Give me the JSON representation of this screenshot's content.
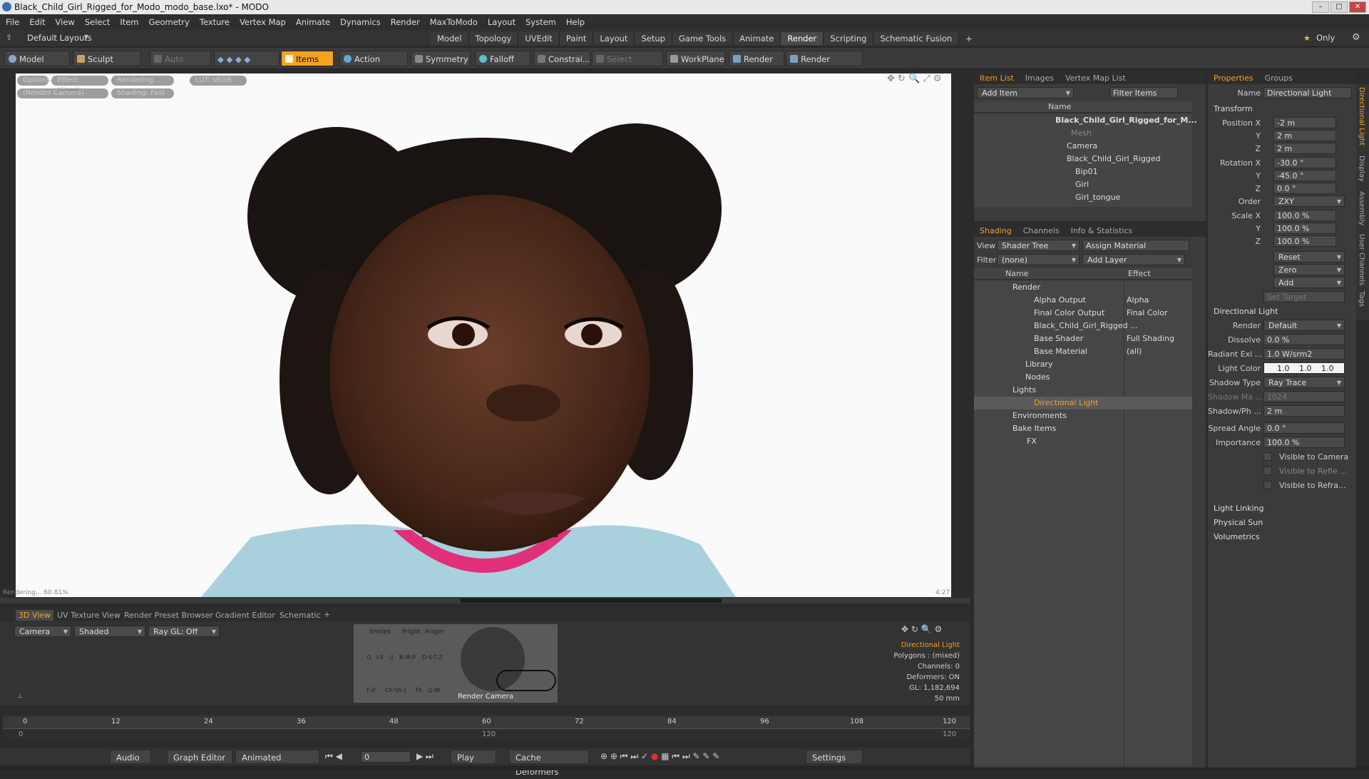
{
  "window": {
    "title": "Black_Child_Girl_Rigged_for_Modo_modo_base.lxo* - MODO"
  },
  "menu": [
    "File",
    "Edit",
    "View",
    "Select",
    "Item",
    "Geometry",
    "Texture",
    "Vertex Map",
    "Animate",
    "Dynamics",
    "Render",
    "MaxToModo",
    "Layout",
    "System",
    "Help"
  ],
  "layout": {
    "current": "Default Layouts",
    "tabs": [
      "Model",
      "Topology",
      "UVEdit",
      "Paint",
      "Layout",
      "Setup",
      "Game Tools",
      "Animate",
      "Render",
      "Scripting",
      "Schematic Fusion"
    ],
    "active_tab": "Render",
    "plus": "+",
    "only": "Only"
  },
  "toolbar": {
    "model": "Model",
    "sculpt": "Sculpt",
    "auto_select": "Auto Select",
    "items": "Items",
    "action_center": "Action Center",
    "symmetry": "Symmetry",
    "falloff": "Falloff",
    "constraints": "Constrai...",
    "select_through": "Select Through",
    "workplane": "WorkPlane",
    "render": "Render",
    "render_window": "Render Window"
  },
  "viewport": {
    "options": "Options",
    "effect": "Effect: (Shadi...",
    "rendering": "Rendering...",
    "lut": "LUT: sRGB",
    "camera": "(Render Camera)",
    "shading": "Shading: Fast",
    "corner_left": "Rendering... 60.81%",
    "corner_right": "4:27"
  },
  "item_list": {
    "tabs": [
      "Item List",
      "Images",
      "Vertex Map List"
    ],
    "add_item": "Add Item",
    "filter_items": "Filter Items",
    "col_name": "Name",
    "items": [
      "Black_Child_Girl_Rigged_for_M...",
      "Mesh",
      "Camera",
      "Black_Child_Girl_Rigged",
      "Bip01",
      "Girl",
      "Girl_tongue"
    ]
  },
  "shading": {
    "tabs": [
      "Shading",
      "Channels",
      "Info & Statistics"
    ],
    "view_label": "View",
    "view_value": "Shader Tree",
    "assign_material": "Assign Material",
    "filter_label": "Filter",
    "filter_value": "(none)",
    "add_layer": "Add Layer",
    "col_name": "Name",
    "col_effect": "Effect",
    "rows": [
      {
        "name": "Render",
        "effect": ""
      },
      {
        "name": "Alpha Output",
        "effect": "Alpha"
      },
      {
        "name": "Final Color Output",
        "effect": "Final Color"
      },
      {
        "name": "Black_Child_Girl_Rigged ...",
        "effect": ""
      },
      {
        "name": "Base Shader",
        "effect": "Full Shading"
      },
      {
        "name": "Base Material",
        "effect": "(all)"
      },
      {
        "name": "Library",
        "effect": ""
      },
      {
        "name": "Nodes",
        "effect": ""
      },
      {
        "name": "Lights",
        "effect": ""
      },
      {
        "name": "Directional Light",
        "effect": ""
      },
      {
        "name": "Environments",
        "effect": ""
      },
      {
        "name": "Bake Items",
        "effect": ""
      },
      {
        "name": "FX",
        "effect": ""
      }
    ]
  },
  "properties": {
    "tabs": [
      "Properties",
      "Groups"
    ],
    "name_label": "Name",
    "name_value": "Directional Light",
    "transform": "Transform",
    "pos_label": "Position X",
    "pos": [
      "-2 m",
      "2 m",
      "2 m"
    ],
    "rot_label": "Rotation X",
    "rot": [
      "-30.0 °",
      "-45.0 °",
      "0.0 °"
    ],
    "y": "Y",
    "z": "Z",
    "order_label": "Order",
    "order": "ZXY",
    "scale_label": "Scale X",
    "scale": [
      "100.0 %",
      "100.0 %",
      "100.0 %"
    ],
    "reset": "Reset",
    "zero": "Zero",
    "add": "Add",
    "set_target": "Set Target",
    "dl_section": "Directional Light",
    "render_label": "Render",
    "render_value": "Default",
    "dissolve_label": "Dissolve",
    "dissolve": "0.0 %",
    "radiant_label": "Radiant Exi ...",
    "radiant": "1.0 W/srm2",
    "lightcolor_label": "Light Color",
    "lightcolor": [
      "1.0",
      "1.0",
      "1.0"
    ],
    "shadowtype_label": "Shadow Type",
    "shadowtype": "Ray Trace",
    "shadowmap_label": "Shadow Ma ...",
    "shadowmap": "1024",
    "shadowph_label": "Shadow/Ph ...",
    "shadowph": "2 m",
    "spread_label": "Spread Angle",
    "spread": "0.0 °",
    "importance_label": "Importance",
    "importance": "100.0 %",
    "vis_camera": "Visible to Camera",
    "vis_refl": "Visible to Refle ...",
    "vis_refr": "Visible to Refra...",
    "light_linking": "Light Linking",
    "physical_sun": "Physical Sun",
    "volumetrics": "Volumetrics",
    "side_tabs": [
      "Directional Light",
      "Display",
      "Assembly",
      "User Channels",
      "Tags"
    ]
  },
  "bottom_panel": {
    "tabs": [
      "3D View",
      "UV Texture View",
      "Render Preset Browser",
      "Gradient Editor",
      "Schematic"
    ],
    "camera": "Camera",
    "shaded": "Shaded",
    "raygl": "Ray GL: Off",
    "render_camera": "Render Camera",
    "face_labels": [
      "Smiles",
      "Fright",
      "Anger",
      "O",
      "I-E",
      "U",
      "B-M-P",
      "D-S-T-Z",
      "F-V",
      "Ch-Sh-J",
      "Th",
      "Q-W"
    ],
    "info": [
      "Directional Light",
      "Polygons : (mixed)",
      "Channels: 0",
      "Deformers: ON",
      "GL: 1,182,694",
      "50 mm"
    ]
  },
  "timeline": {
    "ticks": [
      "0",
      "12",
      "24",
      "36",
      "48",
      "60",
      "72",
      "84",
      "96",
      "108",
      "120"
    ],
    "sub_ticks": [
      "0",
      "120",
      "120"
    ]
  },
  "transport": {
    "audio": "Audio",
    "graph_editor": "Graph Editor",
    "animated": "Animated",
    "frame": "0",
    "play": "Play",
    "cache_deformers": "Cache Deformers",
    "settings": "Settings"
  }
}
